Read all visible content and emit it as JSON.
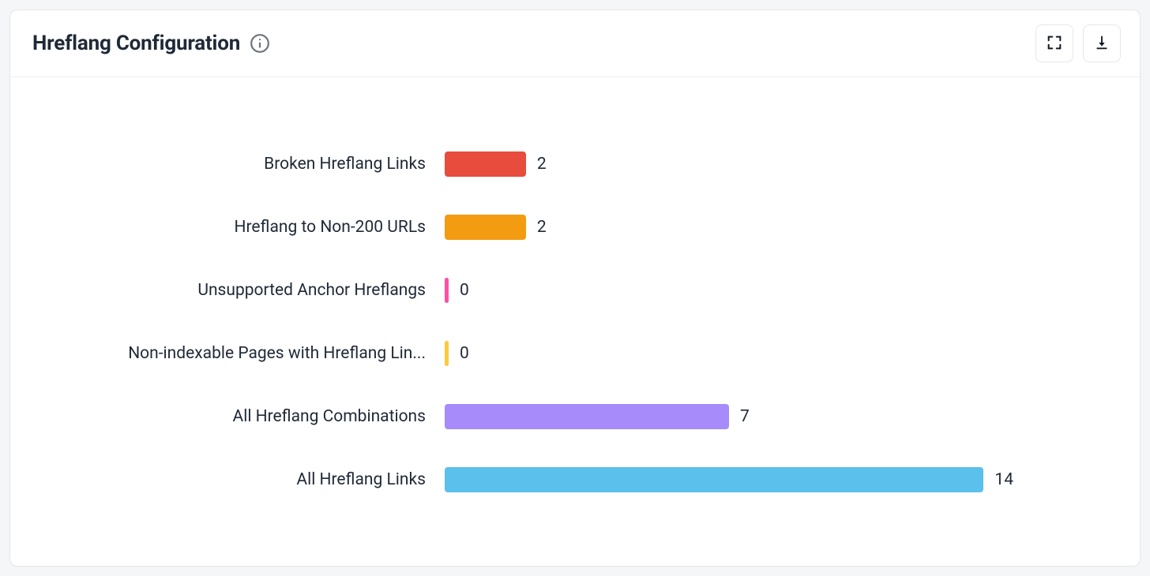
{
  "header": {
    "title": "Hreflang Configuration"
  },
  "chart_data": {
    "type": "bar",
    "orientation": "horizontal",
    "title": "Hreflang Configuration",
    "categories": [
      "Broken Hreflang Links",
      "Hreflang to Non-200 URLs",
      "Unsupported Anchor Hreflangs",
      "Non-indexable Pages with Hreflang Lin...",
      "All Hreflang Combinations",
      "All Hreflang Links"
    ],
    "values": [
      2,
      2,
      0,
      0,
      7,
      14
    ],
    "colors": [
      "#e74c3c",
      "#f39c12",
      "#ff4fa3",
      "#ffc93c",
      "#a78bfa",
      "#5bc0eb"
    ],
    "xlim": [
      0,
      14
    ]
  }
}
